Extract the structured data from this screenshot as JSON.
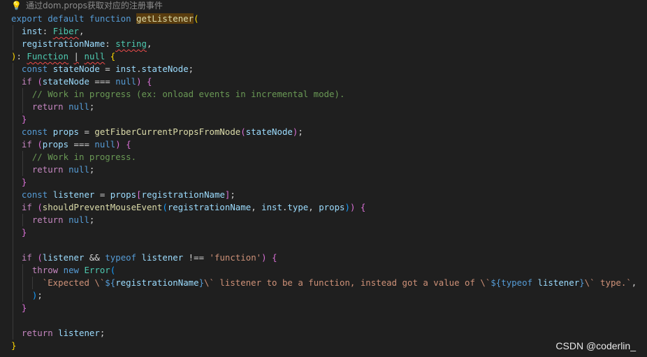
{
  "hint": {
    "icon": "lightbulb-icon",
    "text": "通过dom.props获取对应的注册事件"
  },
  "watermark": "CSDN @coderlin_",
  "lines": [
    [
      [
        "export ",
        "kw"
      ],
      [
        "default ",
        "kw"
      ],
      [
        "function ",
        "kw"
      ],
      [
        "getListener",
        "fn hl"
      ],
      [
        "(",
        "b1"
      ]
    ],
    [
      [
        "  "
      ],
      [
        "inst",
        "var"
      ],
      [
        ": "
      ],
      [
        "Fiber",
        "type squig"
      ],
      [
        ","
      ]
    ],
    [
      [
        "  "
      ],
      [
        "registrationName",
        "var"
      ],
      [
        ": "
      ],
      [
        "string",
        "type squig"
      ],
      [
        ","
      ]
    ],
    [
      [
        ")",
        "b1"
      ],
      [
        ": "
      ],
      [
        "Function",
        "type squig"
      ],
      [
        " "
      ],
      [
        "|",
        "squig"
      ],
      [
        " "
      ],
      [
        "null",
        "type squig"
      ],
      [
        " "
      ],
      [
        "{",
        "b1"
      ]
    ],
    [
      [
        "  "
      ],
      [
        "const ",
        "kw"
      ],
      [
        "stateNode",
        "var"
      ],
      [
        " = "
      ],
      [
        "inst",
        "var"
      ],
      [
        "."
      ],
      [
        "stateNode",
        "var"
      ],
      [
        ";"
      ]
    ],
    [
      [
        "  "
      ],
      [
        "if ",
        "ctrl"
      ],
      [
        "(",
        "b2"
      ],
      [
        "stateNode",
        "var"
      ],
      [
        " === "
      ],
      [
        "null",
        "kw"
      ],
      [
        ")",
        "b2"
      ],
      [
        " "
      ],
      [
        "{",
        "b2"
      ]
    ],
    [
      [
        "    "
      ],
      [
        "// Work in progress (ex: onload events in incremental mode).",
        "comment"
      ]
    ],
    [
      [
        "    "
      ],
      [
        "return ",
        "ctrl"
      ],
      [
        "null",
        "kw"
      ],
      [
        ";"
      ]
    ],
    [
      [
        "  "
      ],
      [
        "}",
        "b2"
      ]
    ],
    [
      [
        "  "
      ],
      [
        "const ",
        "kw"
      ],
      [
        "props",
        "var"
      ],
      [
        " = "
      ],
      [
        "getFiberCurrentPropsFromNode",
        "fn"
      ],
      [
        "(",
        "b2"
      ],
      [
        "stateNode",
        "var"
      ],
      [
        ")",
        "b2"
      ],
      [
        ";"
      ]
    ],
    [
      [
        "  "
      ],
      [
        "if ",
        "ctrl"
      ],
      [
        "(",
        "b2"
      ],
      [
        "props",
        "var"
      ],
      [
        " === "
      ],
      [
        "null",
        "kw"
      ],
      [
        ")",
        "b2"
      ],
      [
        " "
      ],
      [
        "{",
        "b2"
      ]
    ],
    [
      [
        "    "
      ],
      [
        "// Work in progress.",
        "comment"
      ]
    ],
    [
      [
        "    "
      ],
      [
        "return ",
        "ctrl"
      ],
      [
        "null",
        "kw"
      ],
      [
        ";"
      ]
    ],
    [
      [
        "  "
      ],
      [
        "}",
        "b2"
      ]
    ],
    [
      [
        "  "
      ],
      [
        "const ",
        "kw"
      ],
      [
        "listener",
        "var"
      ],
      [
        " = "
      ],
      [
        "props",
        "var"
      ],
      [
        "[",
        "b2"
      ],
      [
        "registrationName",
        "var"
      ],
      [
        "]",
        "b2"
      ],
      [
        ";"
      ]
    ],
    [
      [
        "  "
      ],
      [
        "if ",
        "ctrl"
      ],
      [
        "(",
        "b2"
      ],
      [
        "shouldPreventMouseEvent",
        "fn"
      ],
      [
        "(",
        "b3"
      ],
      [
        "registrationName",
        "var"
      ],
      [
        ", "
      ],
      [
        "inst",
        "var"
      ],
      [
        "."
      ],
      [
        "type",
        "var"
      ],
      [
        ", "
      ],
      [
        "props",
        "var"
      ],
      [
        ")",
        "b3"
      ],
      [
        ")",
        "b2"
      ],
      [
        " "
      ],
      [
        "{",
        "b2"
      ]
    ],
    [
      [
        "    "
      ],
      [
        "return ",
        "ctrl"
      ],
      [
        "null",
        "kw"
      ],
      [
        ";"
      ]
    ],
    [
      [
        "  "
      ],
      [
        "}",
        "b2"
      ]
    ],
    [
      [
        ""
      ]
    ],
    [
      [
        "  "
      ],
      [
        "if ",
        "ctrl"
      ],
      [
        "(",
        "b2"
      ],
      [
        "listener",
        "var"
      ],
      [
        " && "
      ],
      [
        "typeof ",
        "kw"
      ],
      [
        "listener",
        "var"
      ],
      [
        " !== "
      ],
      [
        "'function'",
        "str"
      ],
      [
        ")",
        "b2"
      ],
      [
        " "
      ],
      [
        "{",
        "b2"
      ]
    ],
    [
      [
        "    "
      ],
      [
        "throw ",
        "ctrl"
      ],
      [
        "new ",
        "kw"
      ],
      [
        "Error",
        "type"
      ],
      [
        "(",
        "b3"
      ]
    ],
    [
      [
        "      "
      ],
      [
        "`Expected \\`",
        "str"
      ],
      [
        "${",
        "kw"
      ],
      [
        "registrationName",
        "var"
      ],
      [
        "}",
        "kw"
      ],
      [
        "\\` listener to be a function, instead got a value of \\`",
        "str"
      ],
      [
        "${",
        "kw"
      ],
      [
        "typeof ",
        "kw"
      ],
      [
        "listener",
        "var"
      ],
      [
        "}",
        "kw"
      ],
      [
        "\\` type.`",
        "str"
      ],
      [
        ","
      ]
    ],
    [
      [
        "    "
      ],
      [
        ")",
        "b3"
      ],
      [
        ";"
      ]
    ],
    [
      [
        "  "
      ],
      [
        "}",
        "b2"
      ]
    ],
    [
      [
        ""
      ]
    ],
    [
      [
        "  "
      ],
      [
        "return ",
        "ctrl"
      ],
      [
        "listener",
        "var"
      ],
      [
        ";"
      ]
    ],
    [
      [
        "}",
        "b1"
      ]
    ]
  ]
}
